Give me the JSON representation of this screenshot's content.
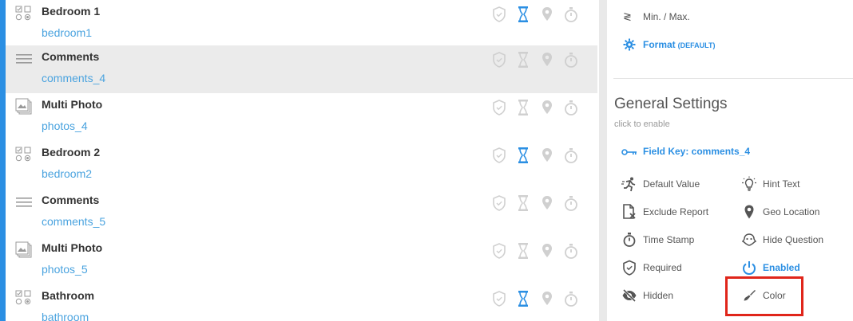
{
  "field_list": [
    {
      "type_icon": "checkbox-radio-icon",
      "title": "Bedroom 1",
      "key": "bedroom1",
      "selected": false,
      "hint_active": true
    },
    {
      "type_icon": "lines-icon",
      "title": "Comments",
      "key": "comments_4",
      "selected": true,
      "hint_active": false
    },
    {
      "type_icon": "photos-icon",
      "title": "Multi Photo",
      "key": "photos_4",
      "selected": false,
      "hint_active": false
    },
    {
      "type_icon": "checkbox-radio-icon",
      "title": "Bedroom 2",
      "key": "bedroom2",
      "selected": false,
      "hint_active": true
    },
    {
      "type_icon": "lines-icon",
      "title": "Comments",
      "key": "comments_5",
      "selected": false,
      "hint_active": false
    },
    {
      "type_icon": "photos-icon",
      "title": "Multi Photo",
      "key": "photos_5",
      "selected": false,
      "hint_active": false
    },
    {
      "type_icon": "checkbox-radio-icon",
      "title": "Bathroom",
      "key": "bathroom",
      "selected": false,
      "hint_active": true
    }
  ],
  "panel": {
    "minmax": {
      "icon": "≷",
      "label": "Min. / Max."
    },
    "format": {
      "label": "Format",
      "default": "(DEFAULT)"
    },
    "general_settings": {
      "title": "General Settings",
      "subtitle": "click to enable"
    },
    "field_key": "Field Key: comments_4",
    "settings_left": [
      {
        "icon": "runner-icon",
        "label": "Default Value"
      },
      {
        "icon": "exclude-file-icon",
        "label": "Exclude Report"
      },
      {
        "icon": "stopwatch-icon",
        "label": "Time Stamp"
      },
      {
        "icon": "shield-icon",
        "label": "Required"
      },
      {
        "icon": "eye-slash-icon",
        "label": "Hidden"
      }
    ],
    "settings_right": [
      {
        "icon": "lightbulb-icon",
        "label": "Hint Text"
      },
      {
        "icon": "map-pin-icon",
        "label": "Geo Location"
      },
      {
        "icon": "hide-question-icon",
        "label": "Hide Question"
      },
      {
        "icon": "power-icon",
        "label": "Enabled",
        "active": true
      },
      {
        "icon": "paint-brush-icon",
        "label": "Color"
      }
    ]
  },
  "colors": {
    "accent": "#2b8fe3",
    "link": "#4aa3df",
    "highlight": "#e0251a",
    "inactive_icon": "#d0d0d0"
  }
}
